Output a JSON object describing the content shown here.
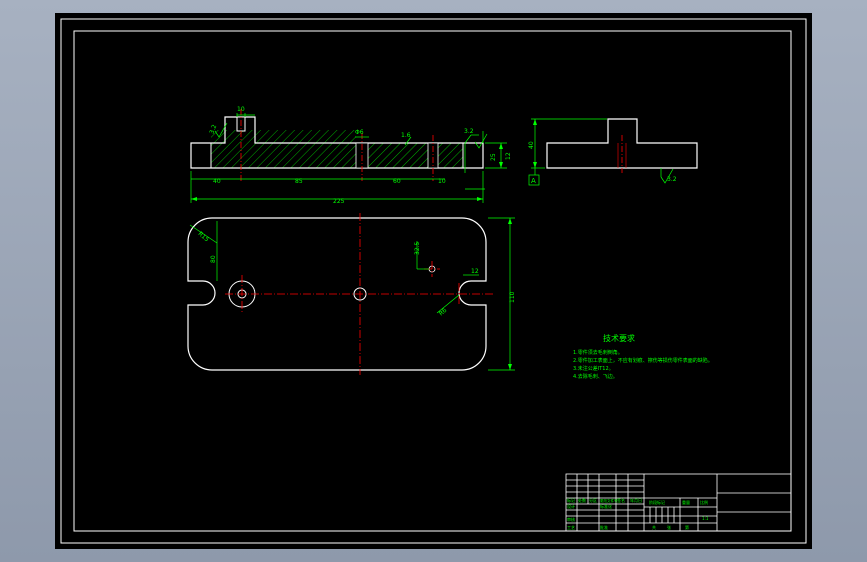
{
  "colors": {
    "background": "#000000",
    "outline": "#ffffff",
    "dimension": "#00ff00",
    "centerline": "#ff0000",
    "hatch": "#00ff00",
    "text": "#00ff00",
    "chrome": "#9aa5b6"
  },
  "front_view": {
    "dim_top_slot": "10",
    "dim_depth": "3.2",
    "dim_hole": "Φ6",
    "dim_tol": "1.6",
    "dim_right_sym": "3.2",
    "dim_height_a": "25",
    "dim_height_b": "12",
    "dim_seg_1": "40",
    "dim_seg_2": "85",
    "dim_seg_3": "60",
    "dim_seg_4": "10",
    "dim_total": "225"
  },
  "side_view": {
    "dim_height": "40",
    "datum_label": "A",
    "roughness": "3.2"
  },
  "plan_view": {
    "dim_radius": "R15",
    "dim_left_height": "80",
    "dim_offset": "32.5",
    "dim_slot_width": "12",
    "dim_slot_radius": "R6",
    "dim_overall_height": "110"
  },
  "notes": {
    "title": "技术要求",
    "lines": [
      "1.零件须去毛刺倒角。",
      "2.零件加工表面上，不应有划痕、擦伤等损伤零件表面的缺陷。",
      "3.未注公差IT12。",
      "4.去除毛刺、飞边。"
    ]
  },
  "title_block": {
    "r1": "标记",
    "r2": "处数",
    "r3": "分区",
    "r4": "更改文件号",
    "r5": "签名",
    "r6": "年月日",
    "design": "设计",
    "std": "标准化",
    "stage": "阶段标记",
    "weight": "重量",
    "scale": "比例",
    "scale_val": "1:1",
    "audit": "审核",
    "process": "工艺",
    "approve": "批准",
    "sheet_total": "共",
    "sheet": "张",
    "sheet_no": "第"
  }
}
